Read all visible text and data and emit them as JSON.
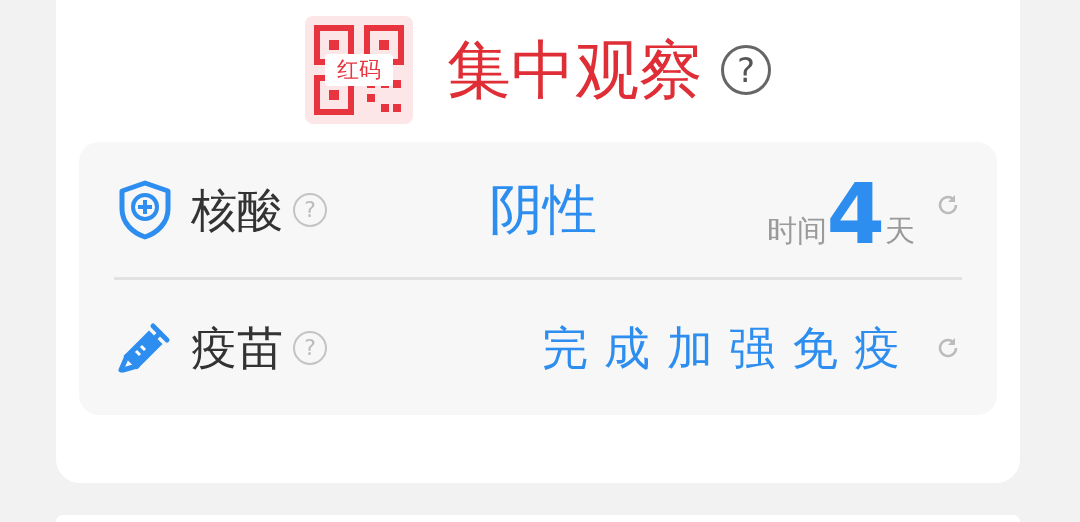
{
  "status": {
    "code_label": "红码",
    "title": "集中观察",
    "help": "?"
  },
  "checks": [
    {
      "kind": "nucleic",
      "label": "核酸",
      "help": "?",
      "result": "阴性",
      "time_prefix": "时间",
      "days": "4",
      "time_suffix": "天"
    },
    {
      "kind": "vaccine",
      "label": "疫苗",
      "help": "?",
      "result": "完成加强免疫"
    }
  ]
}
